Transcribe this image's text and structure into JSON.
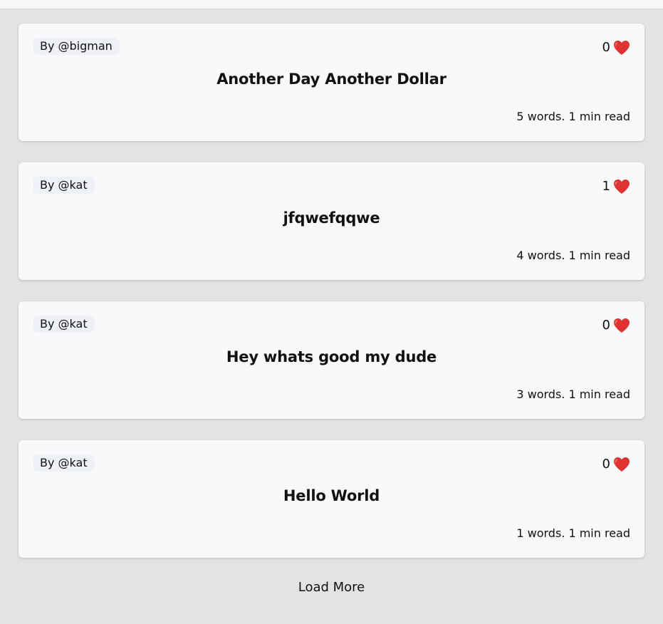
{
  "posts": [
    {
      "author": "By @bigman",
      "likes": "0",
      "title": "Another Day Another Dollar",
      "meta": "5 words. 1 min read"
    },
    {
      "author": "By @kat",
      "likes": "1",
      "title": "jfqwefqqwe",
      "meta": "4 words. 1 min read"
    },
    {
      "author": "By @kat",
      "likes": "0",
      "title": "Hey whats good my dude",
      "meta": "3 words. 1 min read"
    },
    {
      "author": "By @kat",
      "likes": "0",
      "title": "Hello World",
      "meta": "1 words. 1 min read"
    }
  ],
  "load_more_label": "Load More",
  "colors": {
    "background": "#e3e3e3",
    "card": "#f8f9fb",
    "author_pill": "#eef1f8",
    "heart": "#e0322f"
  },
  "icons": {
    "like": "heart-icon"
  }
}
